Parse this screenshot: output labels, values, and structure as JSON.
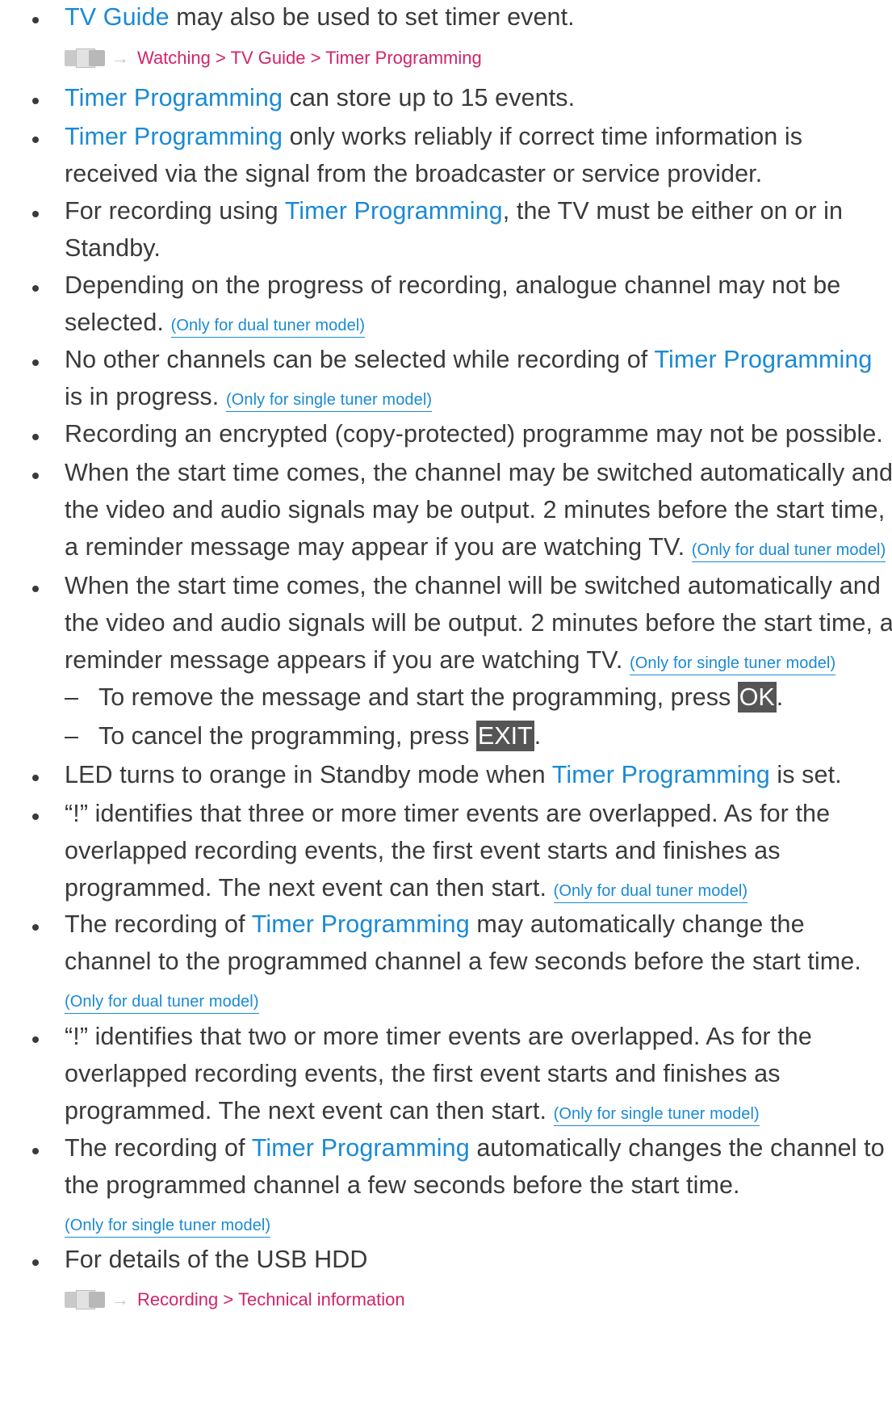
{
  "ref1": {
    "arrow": "→",
    "path": "Watching > TV Guide > Timer Programming"
  },
  "ref2": {
    "arrow": "→",
    "path": "Recording > Technical information"
  },
  "b1": {
    "hl": "TV Guide",
    "rest": " may also be used to set timer event."
  },
  "b2": {
    "hl": "Timer Programming",
    "rest": " can store up to 15 events."
  },
  "b3": {
    "hl": "Timer Programming",
    "rest": " only works reliably if correct time information is received via the signal from the broadcaster or service provider."
  },
  "b4": {
    "pre": "For recording using ",
    "hl": "Timer Programming",
    "rest": ", the TV must be either on or in Standby."
  },
  "b5": {
    "text": "Depending on the progress of recording, analogue channel may not be selected. ",
    "note": "(Only for dual tuner model)"
  },
  "b6": {
    "pre": "No other channels can be selected while recording of ",
    "hl": "Timer Programming",
    "rest": " is in progress. ",
    "note": "(Only for single tuner model)"
  },
  "b7": {
    "text": "Recording an encrypted (copy-protected) programme may not be possible."
  },
  "b8": {
    "text": "When the start time comes, the channel may be switched automatically and the video and audio signals may be output. 2 minutes before the start time, a reminder message may appear if you are watching TV. ",
    "note": "(Only for dual tuner model)"
  },
  "b9": {
    "text": "When the start time comes, the channel will be switched automatically and the video and audio signals will be output. 2 minutes before the start time, a reminder message appears if you are watching TV. ",
    "note": "(Only for single tuner model)"
  },
  "d1": {
    "mark": "–",
    "text": "To remove the message and start the programming, press ",
    "key": "OK",
    "end": "."
  },
  "d2": {
    "mark": "–",
    "text": "To cancel the programming, press ",
    "key": "EXIT",
    "end": "."
  },
  "b10": {
    "pre": "LED turns to orange in Standby mode when ",
    "hl": "Timer Programming",
    "rest": " is set."
  },
  "b11": {
    "text": "“!” identifies that three or more timer events are overlapped. As for the overlapped recording events, the first event starts and finishes as programmed. The next event can then start. ",
    "note": "(Only for dual tuner model)"
  },
  "b12": {
    "pre": "The recording of ",
    "hl": "Timer Programming",
    "rest": " may automatically change the channel to the programmed channel a few seconds before the start time. ",
    "note": "(Only for dual tuner model)"
  },
  "b13": {
    "text": "“!” identifies that two or more timer events are overlapped. As for the overlapped recording events, the first event starts and finishes as programmed. The next event can then start. ",
    "note": "(Only for single tuner model)"
  },
  "b14": {
    "pre": "The recording of ",
    "hl": "Timer Programming",
    "rest": " automatically changes the channel to the programmed channel a few seconds before the start time. ",
    "note": "(Only for single tuner model)"
  },
  "b15": {
    "text": "For details of the USB HDD"
  }
}
